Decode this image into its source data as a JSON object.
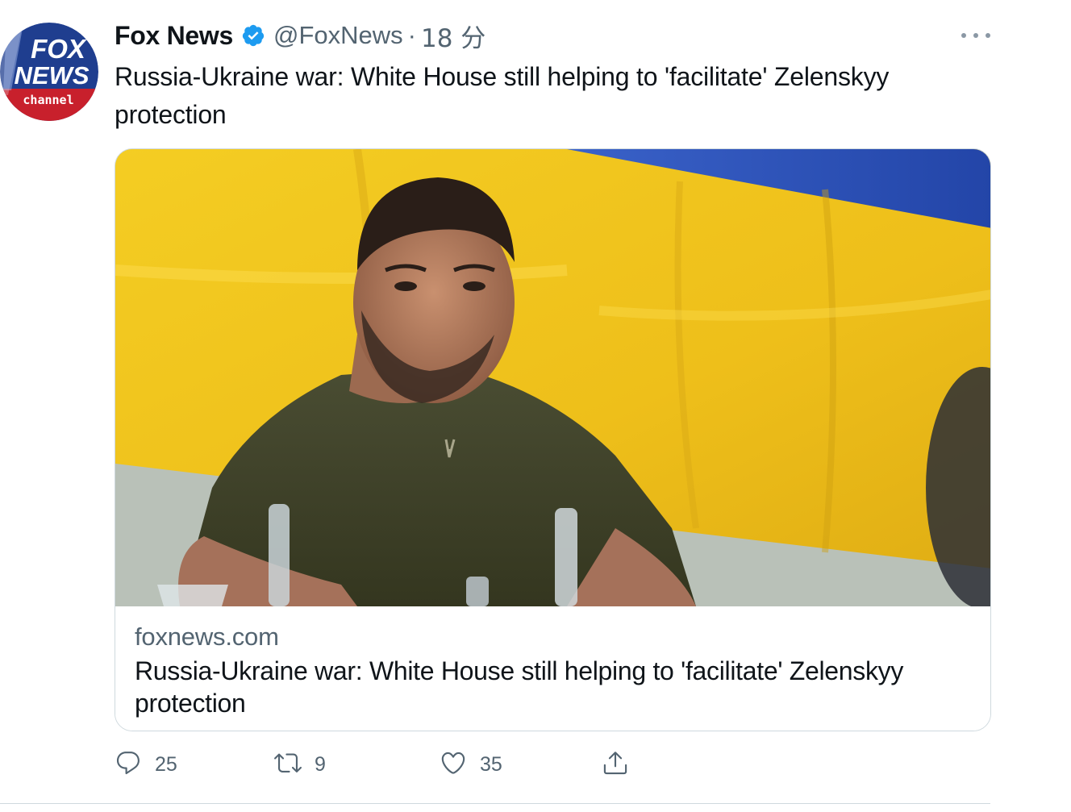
{
  "author": {
    "name": "Fox News",
    "handle": "@FoxNews",
    "separator": "·",
    "time": "18 分",
    "verified": true,
    "avatar_logo": {
      "line1": "FOX",
      "line2": "NEWS",
      "line3": "channel"
    }
  },
  "tweet": {
    "text": "Russia-Ukraine war: White House still helping to 'facilitate' Zelenskyy protection"
  },
  "card": {
    "domain": "foxnews.com",
    "title": "Russia-Ukraine war: White House still helping to 'facilitate' Zelenskyy protection",
    "image_description_icon": "photo-man-in-front-of-ukrainian-flag"
  },
  "actions": {
    "reply_count": "25",
    "retweet_count": "9",
    "like_count": "35"
  },
  "icons": {
    "verified": "verified-badge-icon",
    "more": "more-icon",
    "reply": "reply-icon",
    "retweet": "retweet-icon",
    "like": "heart-icon",
    "share": "share-icon"
  },
  "colors": {
    "verified_blue": "#1d9bf0",
    "secondary_text": "#536471",
    "border": "#cfd9de",
    "flag_blue": "#2f58c8",
    "flag_yellow": "#f1c71c",
    "fox_blue": "#1f3e8f",
    "fox_red": "#c8202c"
  }
}
